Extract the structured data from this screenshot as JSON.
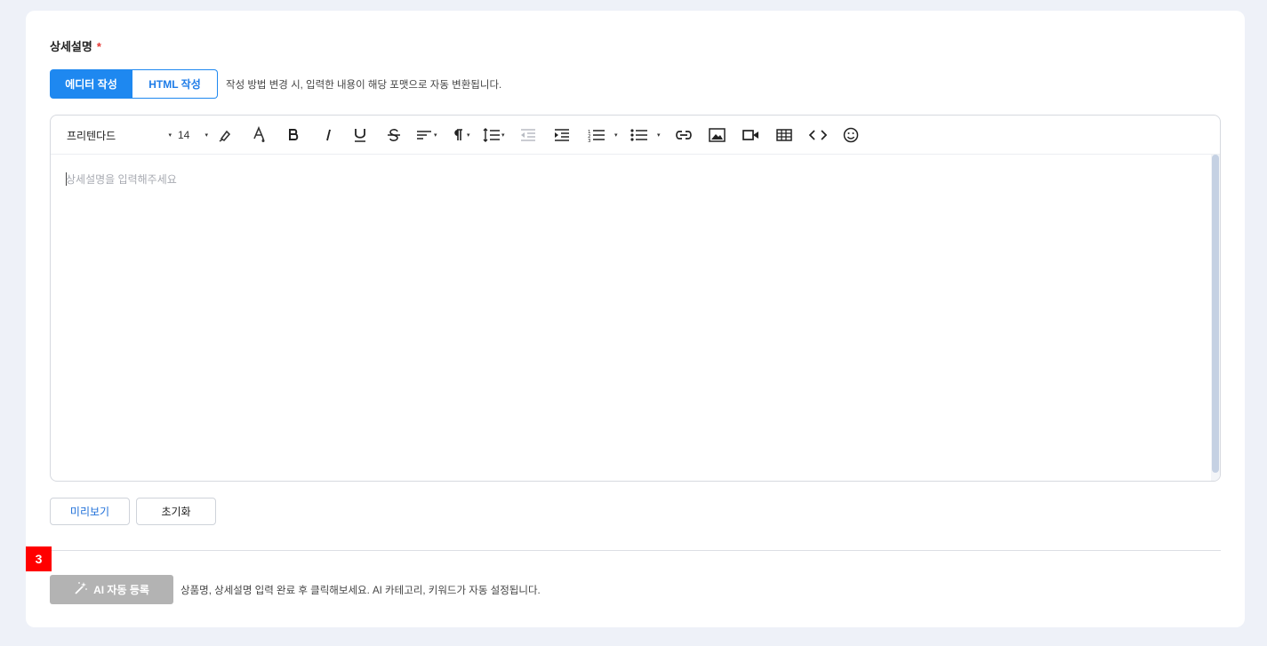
{
  "section": {
    "title": "상세설명",
    "required_mark": "*"
  },
  "mode_toggle": {
    "editor_label": "에디터 작성",
    "html_label": "HTML 작성",
    "hint": "작성 방법 변경 시, 입력한 내용이 해당 포맷으로 자동 변환됩니다."
  },
  "toolbar": {
    "font_family": "프리텐다드",
    "font_size": "14",
    "caret": "▾",
    "icons": [
      "highlighter-icon",
      "text-color-icon",
      "bold-icon",
      "italic-icon",
      "underline-icon",
      "strikethrough-icon",
      "align-icon",
      "paragraph-icon",
      "line-height-icon",
      "outdent-icon",
      "indent-icon",
      "ordered-list-icon",
      "unordered-list-icon",
      "link-icon",
      "image-icon",
      "video-icon",
      "table-icon",
      "code-view-icon",
      "emoji-icon"
    ]
  },
  "editor": {
    "placeholder": "상세설명을 입력해주세요"
  },
  "actions": {
    "preview_label": "미리보기",
    "reset_label": "초기화"
  },
  "ai": {
    "step_badge": "3",
    "button_label": "AI 자동 등록",
    "hint": "상품명, 상세설명 입력 완료 후 클릭해보세요. AI 카테고리, 키워드가 자동 설정됩니다."
  },
  "colors": {
    "primary": "#1e88f0",
    "badge": "#ff0000",
    "disabled_button": "#b3b3b3",
    "required": "#e53935"
  }
}
